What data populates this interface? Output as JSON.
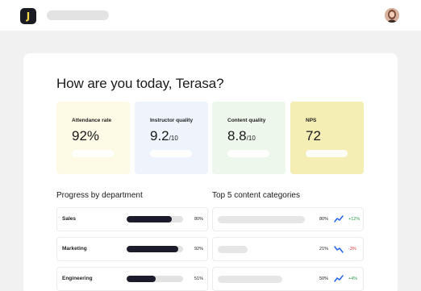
{
  "header": {
    "logo_letter": "J",
    "logo_icon": "brand-logo-icon",
    "avatar_icon": "user-avatar"
  },
  "greeting": "How are you today, Terasa?",
  "kpis": [
    {
      "label": "Attendance rate",
      "value": "92%",
      "unit": "",
      "bg": "#fdfae6"
    },
    {
      "label": "Instructor quality",
      "value": "9.2",
      "unit": "/10",
      "bg": "#eef3fc"
    },
    {
      "label": "Content quality",
      "value": "8.8",
      "unit": "/10",
      "bg": "#eef7ec"
    },
    {
      "label": "NPS",
      "value": "72",
      "unit": "",
      "bg": "#f4edb4"
    }
  ],
  "progress": {
    "title": "Progress by department",
    "rows": [
      {
        "label": "Sales",
        "percent_text": "80%",
        "value": 0.8
      },
      {
        "label": "Marketing",
        "percent_text": "92%",
        "value": 0.92
      },
      {
        "label": "Engineering",
        "percent_text": "51%",
        "value": 0.51
      }
    ]
  },
  "categories": {
    "title": "Top 5 content categories",
    "rows": [
      {
        "percent_text": "80%",
        "delta": "+12%",
        "trend": "up",
        "color": "#2e9e4f",
        "icon": "trend-up-icon",
        "icon_color": "#2563eb"
      },
      {
        "percent_text": "21%",
        "delta": "-3%",
        "trend": "down",
        "color": "#e03c3c",
        "icon": "trend-down-icon",
        "icon_color": "#2563eb"
      },
      {
        "percent_text": "50%",
        "delta": "+4%",
        "trend": "up",
        "color": "#2e9e4f",
        "icon": "trend-up-icon",
        "icon_color": "#2563eb"
      }
    ]
  }
}
